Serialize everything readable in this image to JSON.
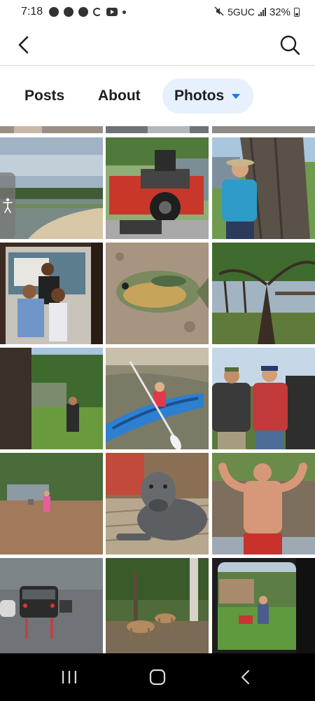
{
  "status_bar": {
    "time": "7:18",
    "network": "5GUC",
    "battery": "32%",
    "notification_icons": [
      "messenger-icon",
      "facebook-icon",
      "pinwheel-icon",
      "sync-icon",
      "youtube-icon",
      "dot-icon"
    ]
  },
  "header": {
    "back_icon": "chevron-left-icon",
    "search_icon": "search-icon"
  },
  "tabs": {
    "items": [
      {
        "label": "Posts"
      },
      {
        "label": "About"
      },
      {
        "label": "Photos",
        "selected": true
      }
    ],
    "selected_bg": "#e7f0fd",
    "accent": "#1877f2"
  },
  "photos": [
    "strip-top-left",
    "strip-top-middle",
    "strip-top-right",
    "lake-shore",
    "gravely-mower",
    "man-by-tree",
    "family-portrait",
    "fish-on-ground",
    "pond-with-tree",
    "yard-with-tree",
    "girl-in-kayak",
    "two-men-outdoors",
    "child-in-field",
    "gray-dog-on-deck",
    "flexing-man",
    "traffic-in-rain",
    "deer-in-woods",
    "man-mowing-lawn"
  ],
  "nav_bar": {
    "icons": [
      "recents-icon",
      "home-icon",
      "back-icon"
    ]
  }
}
